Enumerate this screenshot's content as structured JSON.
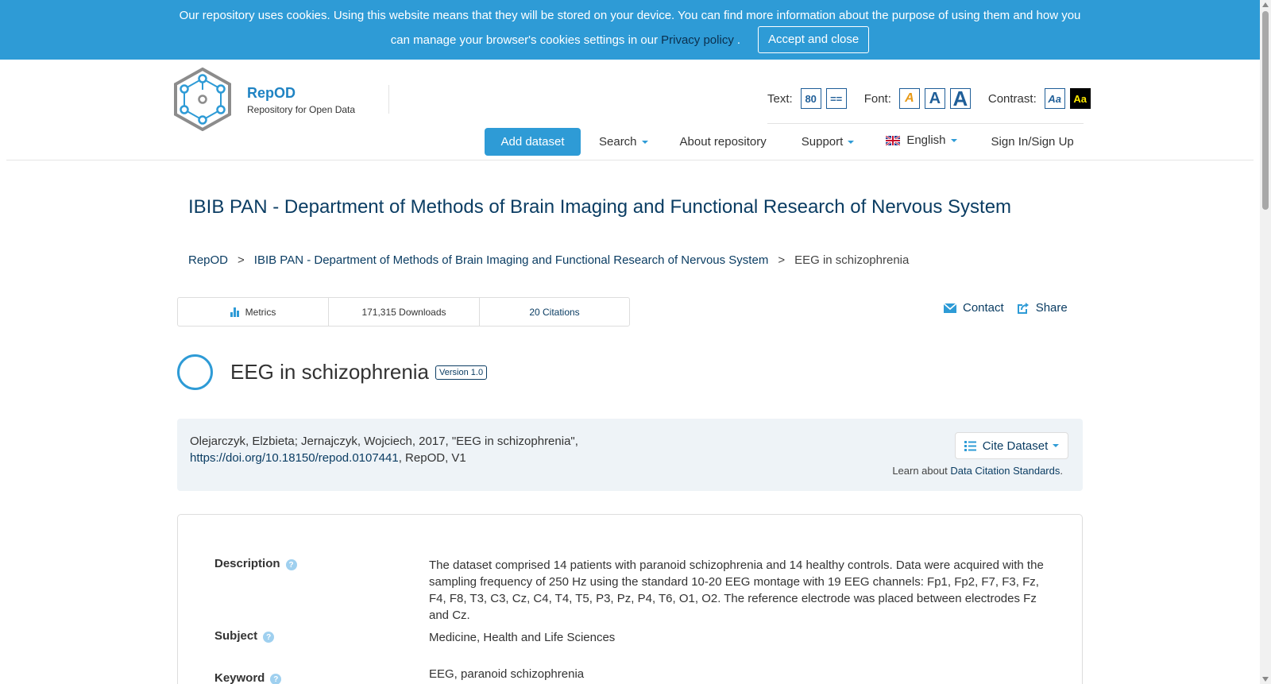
{
  "cookie": {
    "text_line1": "Our repository uses cookies. Using this website means that they will be stored on your device. You can find more information about the purpose of using them and how you",
    "text_line2": "can manage your browser's cookies settings in our",
    "privacy_link": "Privacy policy",
    "after_link": ".",
    "accept_label": "Accept and close"
  },
  "brand": {
    "name": "RepOD",
    "subtitle": "Repository for Open Data"
  },
  "accessibility": {
    "text_label": "Text:",
    "text_size_button": "80",
    "text_spacing_button": "==",
    "font_label": "Font:",
    "font_small": "A",
    "font_medium": "A",
    "font_large": "A",
    "contrast_label": "Contrast:",
    "contrast_normal": "Aa",
    "contrast_high": "Aa"
  },
  "nav": {
    "add_dataset": "Add dataset",
    "search": "Search",
    "about": "About repository",
    "support": "Support",
    "language": "English",
    "sign_in": "Sign In/Sign Up"
  },
  "page": {
    "title": "IBIB PAN - Department of Methods of Brain Imaging and Functional Research of Nervous System",
    "breadcrumb": [
      "RepOD",
      "IBIB PAN - Department of Methods of Brain Imaging and Functional Research of Nervous System",
      "EEG in schizophrenia"
    ],
    "breadcrumb_sep": ">"
  },
  "metrics": {
    "metrics_label": "Metrics",
    "downloads": "171,315 Downloads",
    "citations": "20 Citations"
  },
  "actions": {
    "contact": "Contact",
    "share": "Share"
  },
  "dataset": {
    "title": "EEG in schizophrenia",
    "version": "Version 1.0",
    "citation_text": "Olejarczyk, Elzbieta; Jernajczyk, Wojciech, 2017, \"EEG in schizophrenia\",",
    "citation_doi": "https://doi.org/10.18150/repod.0107441",
    "citation_tail": ", RepOD, V1",
    "cite_button": "Cite Dataset",
    "learn_about": "Learn about",
    "learn_link": "Data Citation Standards",
    "learn_end": "."
  },
  "fields": [
    {
      "label": "Description",
      "value": "The dataset comprised 14 patients with paranoid schizophrenia and 14 healthy controls. Data were acquired with the sampling frequency of 250 Hz using the standard 10-20 EEG montage with 19 EEG channels: Fp1, Fp2, F7, F3, Fz, F4, F8, T3, C3, Cz, C4, T4, T5, P3, Pz, P4, T6, O1, O2. The reference electrode was placed between electrodes Fz and Cz."
    },
    {
      "label": "Subject",
      "value": "Medicine, Health and Life Sciences"
    },
    {
      "label": "Keyword",
      "value": "EEG, paranoid schizophrenia"
    }
  ],
  "help_icon_glyph": "?",
  "colors": {
    "banner": "#2e9bd6",
    "accent": "#2e9bd6",
    "link": "#0b3d63",
    "brand": "#1f83c3"
  }
}
